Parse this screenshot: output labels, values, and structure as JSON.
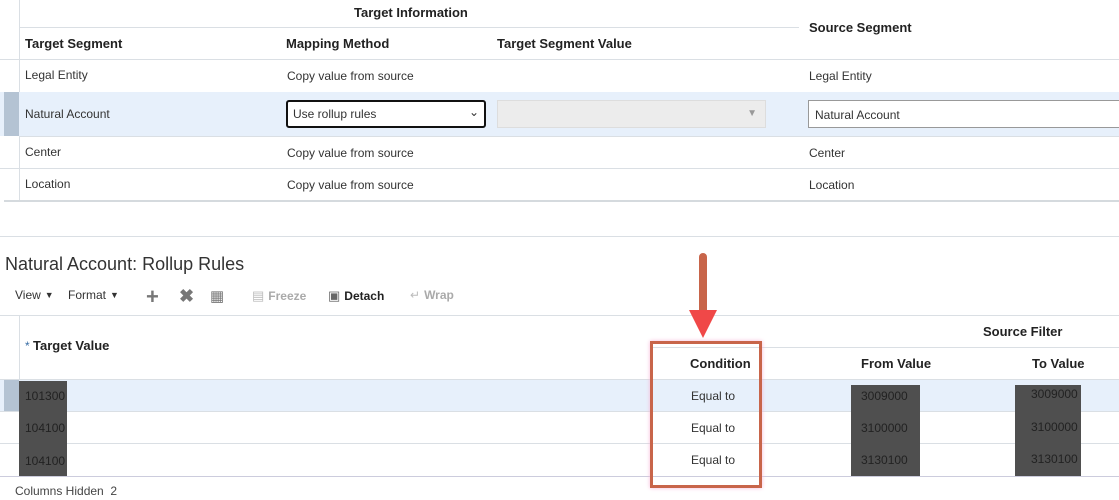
{
  "mapping": {
    "group_header": "Target Information",
    "columns": [
      "Target Segment",
      "Mapping Method",
      "Target Segment Value",
      "Source Segment"
    ],
    "rows": [
      {
        "segment": "Legal Entity",
        "method": "Copy value from source",
        "source": "Legal Entity"
      },
      {
        "segment": "Natural Account",
        "method": "Use rollup rules",
        "source": "Natural Account"
      },
      {
        "segment": "Center",
        "method": "Copy value from source",
        "source": "Center"
      },
      {
        "segment": "Location",
        "method": "Copy value from source",
        "source": "Location"
      }
    ]
  },
  "rollup": {
    "title": "Natural Account: Rollup Rules",
    "toolbar": {
      "view": "View",
      "format": "Format",
      "freeze": "Freeze",
      "detach": "Detach",
      "wrap": "Wrap"
    },
    "required_mark": "*",
    "columns": {
      "target": "Target Value",
      "group": "Source Filter",
      "condition": "Condition",
      "from": "From Value",
      "to": "To Value"
    },
    "rows": [
      {
        "target": "101300",
        "condition": "Equal to",
        "from": "3009000",
        "to": "3009000"
      },
      {
        "target": "104100",
        "condition": "Equal to",
        "from": "3100000",
        "to": "3100000"
      },
      {
        "target": "104100",
        "condition": "Equal to",
        "from": "3130100",
        "to": "3130100"
      }
    ],
    "columns_hidden_label": "Columns Hidden",
    "columns_hidden_count": "2"
  },
  "colors": {
    "highlight": "#c8654a",
    "arrow": "#d9534f"
  }
}
